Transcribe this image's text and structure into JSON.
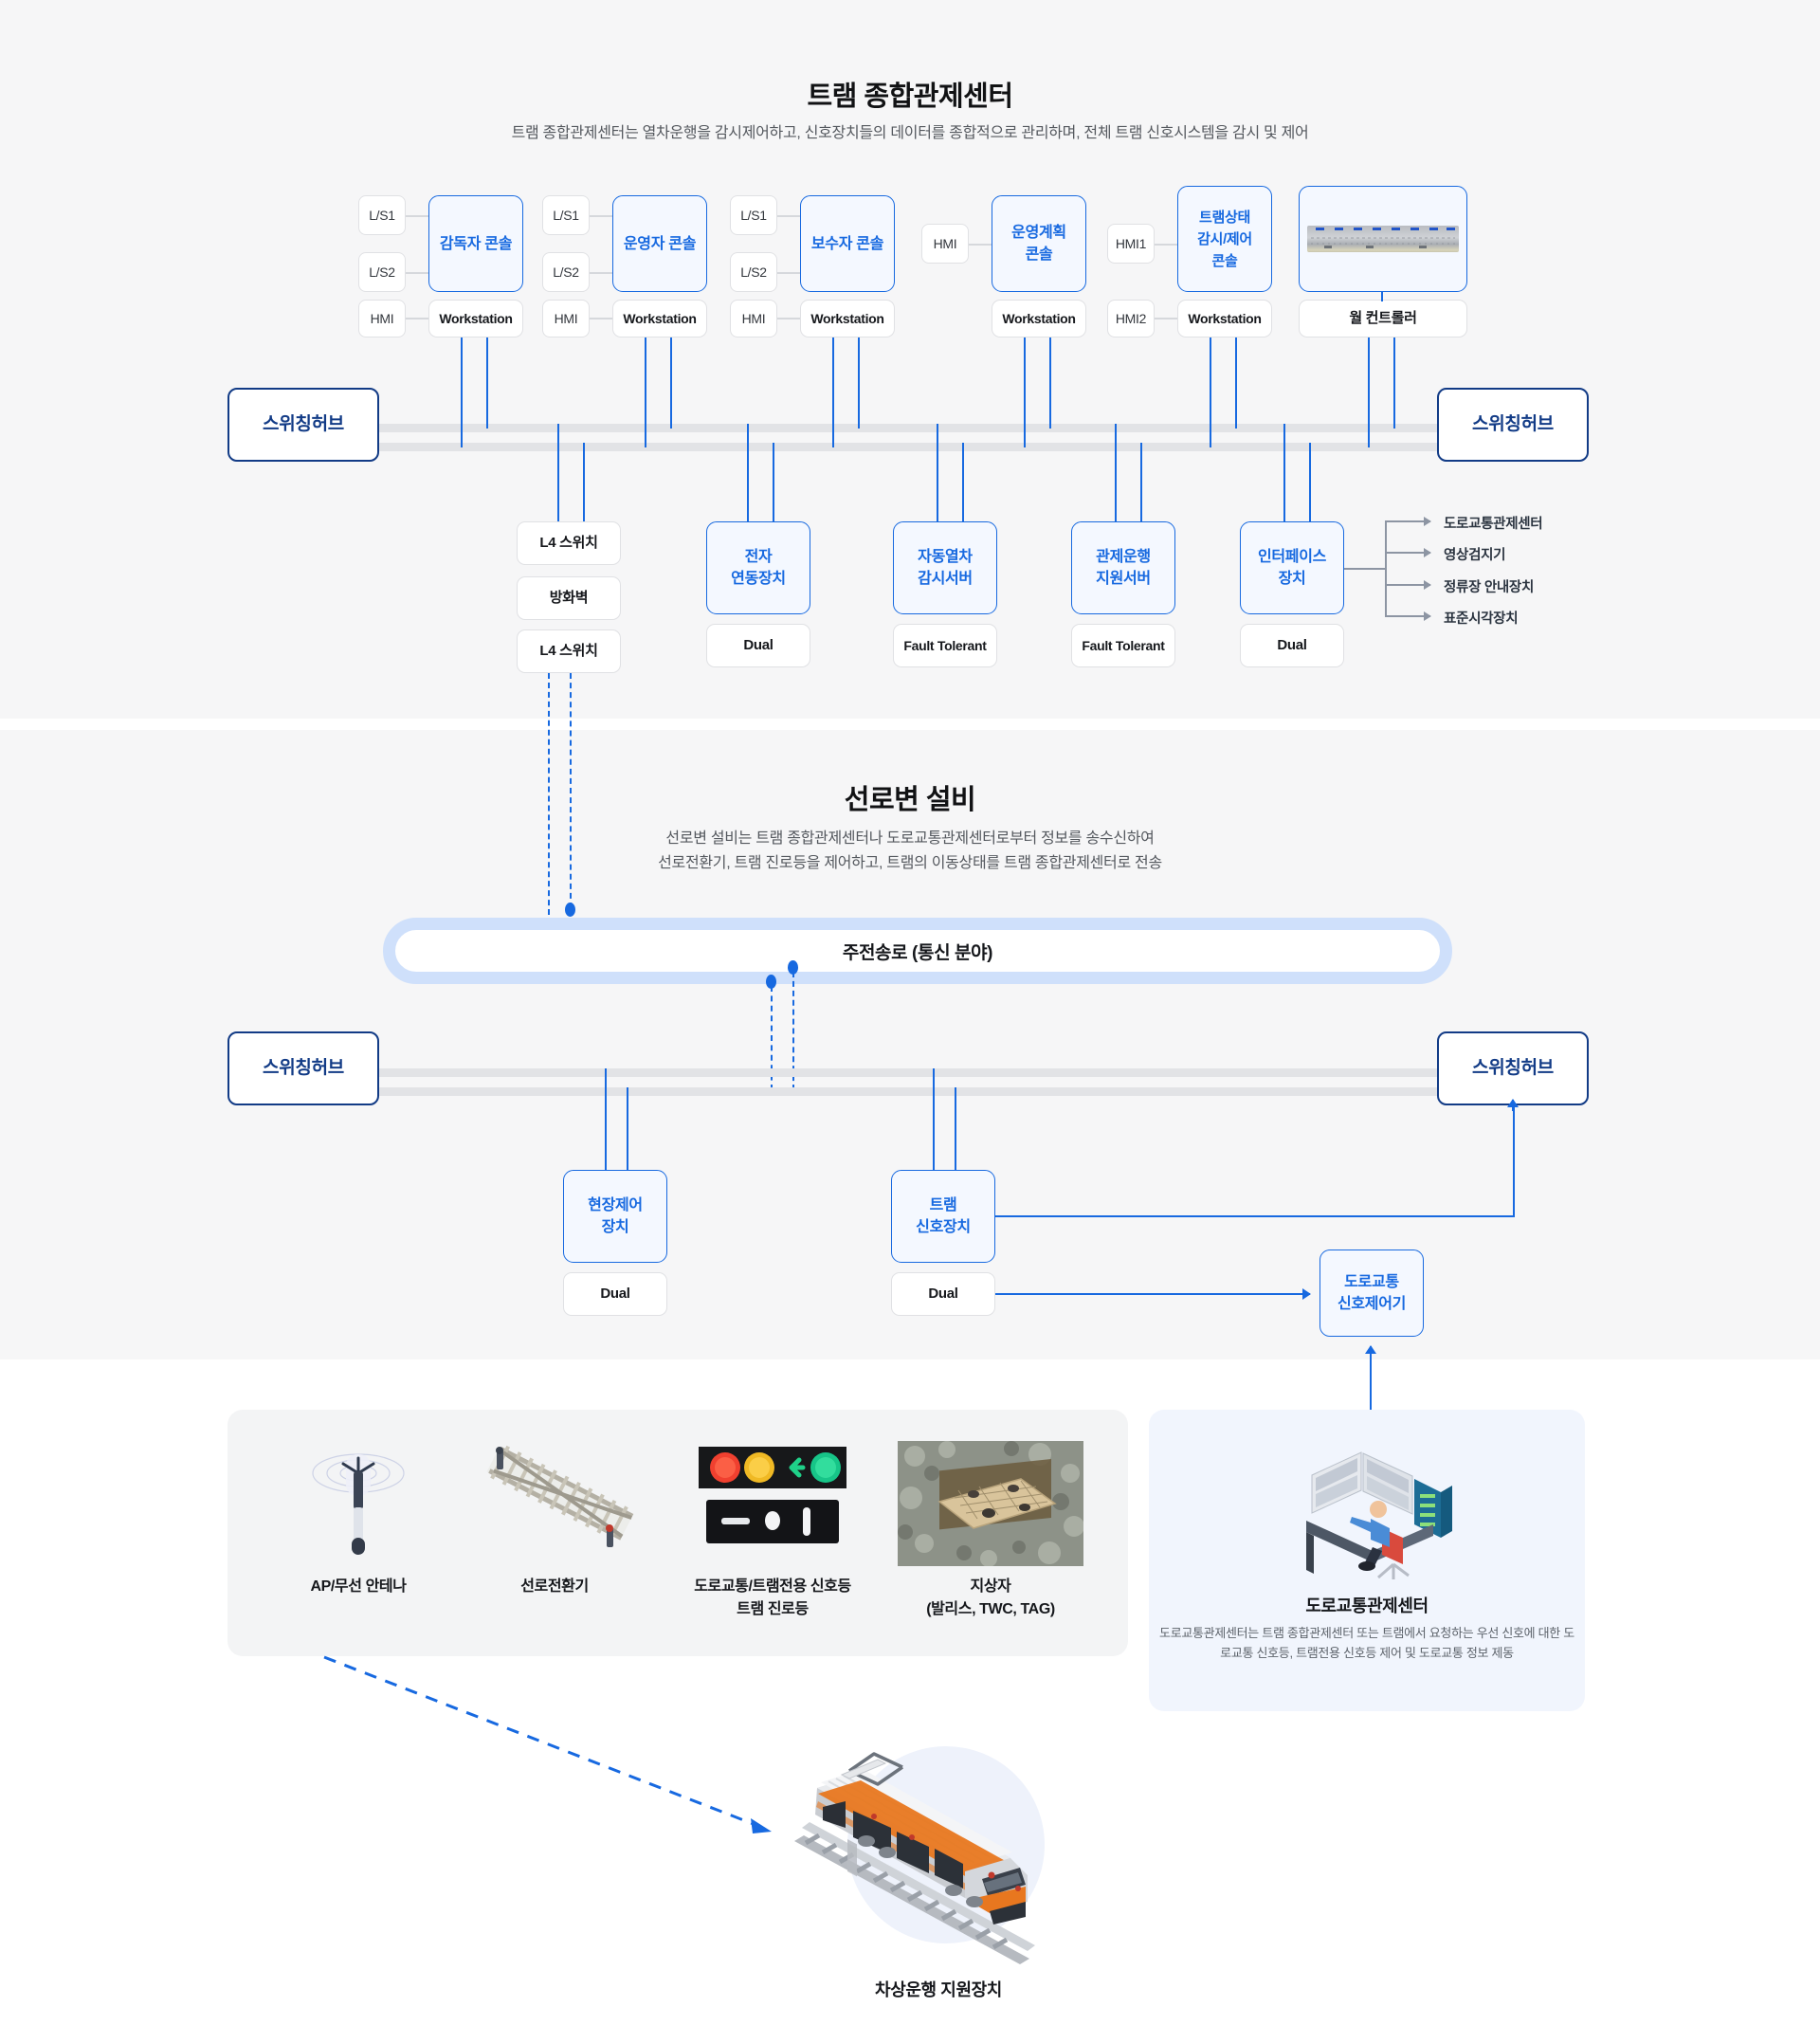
{
  "sections": {
    "control_center": {
      "title": "트램 종합관제센터",
      "desc": "트램 종합관제센터는 열차운행을 감시제어하고, 신호장치들의 데이터를 종합적으로 관리하며, 전체 트램 신호시스템을 감시 및 제어",
      "hub_left": "스위칭허브",
      "hub_right": "스위칭허브",
      "consoles": [
        {
          "name": "감독자 콘솔",
          "io": [
            "L/S1",
            "L/S2",
            "HMI"
          ],
          "workstation": "Workstation"
        },
        {
          "name": "운영자 콘솔",
          "io": [
            "L/S1",
            "L/S2",
            "HMI"
          ],
          "workstation": "Workstation"
        },
        {
          "name": "보수자 콘솔",
          "io": [
            "L/S1",
            "L/S2",
            "HMI"
          ],
          "workstation": "Workstation"
        },
        {
          "name": "운영계획\n콘솔",
          "io": [
            "HMI"
          ],
          "workstation": "Workstation"
        },
        {
          "name": "트램상태\n감시/제어\n콘솔",
          "io": [
            "HMI1",
            "HMI2"
          ],
          "workstation": "Workstation"
        }
      ],
      "wall_controller": {
        "label": "월 컨트롤러",
        "image_name": "wall-display-photo"
      },
      "lower_devices": [
        {
          "name": "L4 스위치",
          "kind": "plain"
        },
        {
          "name": "방화벽",
          "kind": "plain"
        },
        {
          "name": "L4 스위치",
          "kind": "plain"
        },
        {
          "name": "전자\n연동장치",
          "kind": "accent",
          "sub": "Dual"
        },
        {
          "name": "자동열차\n감시서버",
          "kind": "accent",
          "sub": "Fault Tolerant"
        },
        {
          "name": "관제운행\n지원서버",
          "kind": "accent",
          "sub": "Fault Tolerant"
        },
        {
          "name": "인터페이스\n장치",
          "kind": "accent",
          "sub": "Dual"
        }
      ],
      "interface_outputs": [
        "도로교통관제센터",
        "영상검지기",
        "정류장 안내장치",
        "표준시각장치"
      ]
    },
    "wayside": {
      "title": "선로변 설비",
      "desc_line1": "선로변 설비는 트램 종합관제센터나 도로교통관제센터로부터 정보를 송수신하여",
      "desc_line2": "선로전환기, 트램 진로등을 제어하고, 트램의 이동상태를 트램 종합관제센터로 전송",
      "trunk": "주전송로 (통신 분야)",
      "hub_left": "스위칭허브",
      "hub_right": "스위칭허브",
      "devices": [
        {
          "name": "현장제어\n장치",
          "sub": "Dual"
        },
        {
          "name": "트램\n신호장치",
          "sub": "Dual"
        }
      ],
      "road_signal_controller": "도로교통\n신호제어기"
    },
    "gallery": {
      "items": [
        {
          "caption": "AP/무선 안테나",
          "image_name": "antenna-illustration"
        },
        {
          "caption": "선로전환기",
          "image_name": "track-switch-illustration"
        },
        {
          "caption": "도로교통/트램전용 신호등\n트램 진로등",
          "image_name": "traffic-signal-photo"
        },
        {
          "caption": "지상자\n(발리스, TWC, TAG)",
          "image_name": "balise-photo"
        }
      ]
    },
    "road_traffic_center": {
      "title": "도로교통관제센터",
      "desc": "도로교통관제센터는 트램 종합관제센터 또는 트램에서 요청하는 우선 신호에 대한 도로교통 신호등, 트램전용 신호등 제어 및 도로교통 정보 제동",
      "image_name": "operator-desk-illustration"
    },
    "tram": {
      "caption": "차상운행 지원장치",
      "image_name": "tram-illustration"
    }
  },
  "colors": {
    "accent_blue": "#1769e0",
    "deep_navy": "#123b86",
    "section_bg": "#f6f6f7",
    "card_bg": "#f3f4f5",
    "rtcc_bg": "#f1f5fd",
    "bus_grey": "#e2e3e6",
    "fan_grey": "#8d95a3"
  }
}
